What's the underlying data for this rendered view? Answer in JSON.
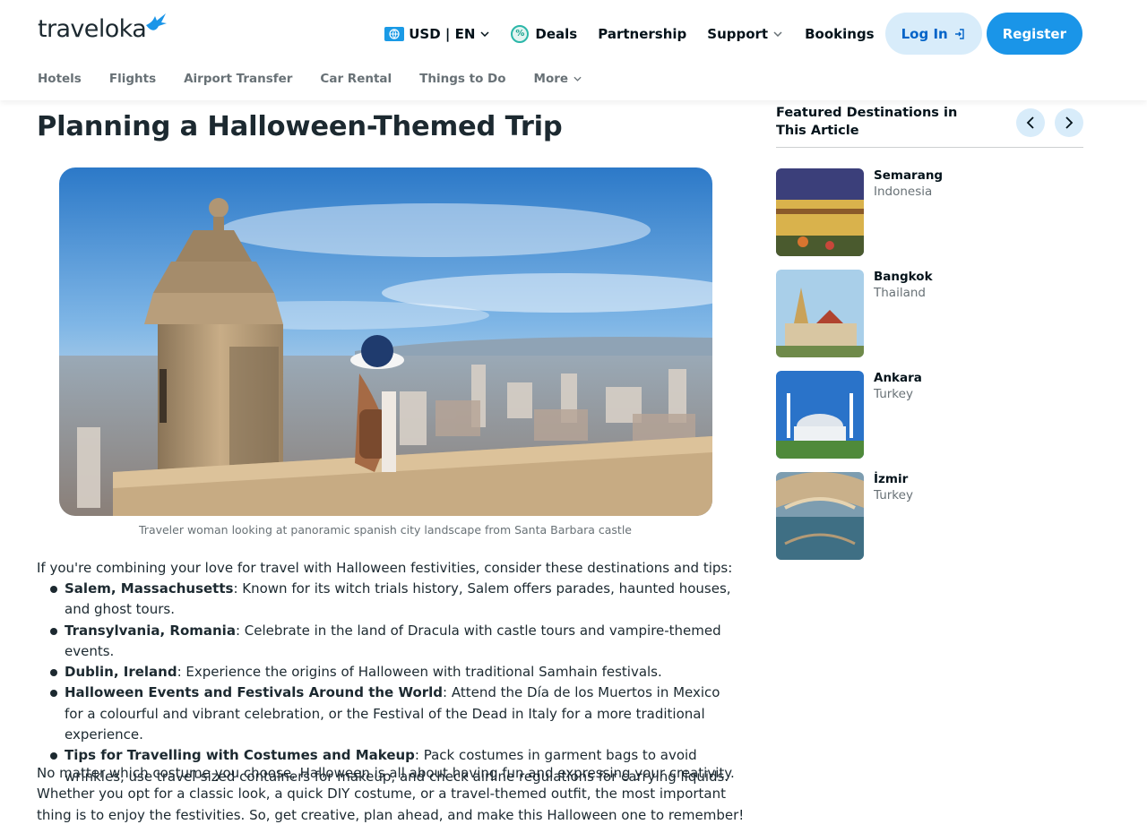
{
  "header": {
    "logo_text": "traveloka",
    "currency_lang": "USD | EN",
    "nav": {
      "deals": "Deals",
      "partnership": "Partnership",
      "support": "Support",
      "bookings": "Bookings",
      "login": "Log In",
      "register": "Register"
    },
    "subnav": [
      "Hotels",
      "Flights",
      "Airport Transfer",
      "Car Rental",
      "Things to Do",
      "More"
    ]
  },
  "colors": {
    "brand_blue": "#1a95e8",
    "login_bg": "#d8ecfa",
    "text_dark": "#1c2930",
    "text_muted": "#687176"
  },
  "article": {
    "title": "Planning a Halloween-Themed Trip",
    "image_caption": "Traveler woman looking at panoramic spanish city landscape from Santa Barbara castle",
    "intro": "If you're combining your love for travel with Halloween festivities, consider these destinations and tips:",
    "tips": [
      {
        "name": "Salem, Massachusetts",
        "text": ": Known for its witch trials history, Salem offers parades, haunted houses, and ghost tours."
      },
      {
        "name": "Transylvania, Romania",
        "text": ": Celebrate in the land of Dracula with castle tours and vampire-themed events."
      },
      {
        "name": "Dublin, Ireland",
        "text": ": Experience the origins of Halloween with traditional Samhain festivals."
      },
      {
        "name": "Halloween Events and Festivals Around the World",
        "text": ": Attend the Día de los Muertos in Mexico for a colourful and vibrant celebration, or the Festival of the Dead in Italy for a more traditional experience."
      },
      {
        "name": "Tips for Travelling with Costumes and Makeup",
        "text": ": Pack costumes in garment bags to avoid wrinkles, use travel-sized containers for makeup, and check airline regulations for carrying liquids."
      }
    ],
    "closing": "No matter which costume you choose, Halloween is all about having fun and expressing your creativity. Whether you opt for a classic look, a quick DIY costume, or a travel-themed outfit, the most important thing is to enjoy the festivities. So, get creative, plan ahead, and make this Halloween one to remember!"
  },
  "sidebar": {
    "title": "Featured Destinations in This Article",
    "destinations": [
      {
        "city": "Semarang",
        "country": "Indonesia"
      },
      {
        "city": "Bangkok",
        "country": "Thailand"
      },
      {
        "city": "Ankara",
        "country": "Turkey"
      },
      {
        "city": "İzmir",
        "country": "Turkey"
      }
    ]
  }
}
